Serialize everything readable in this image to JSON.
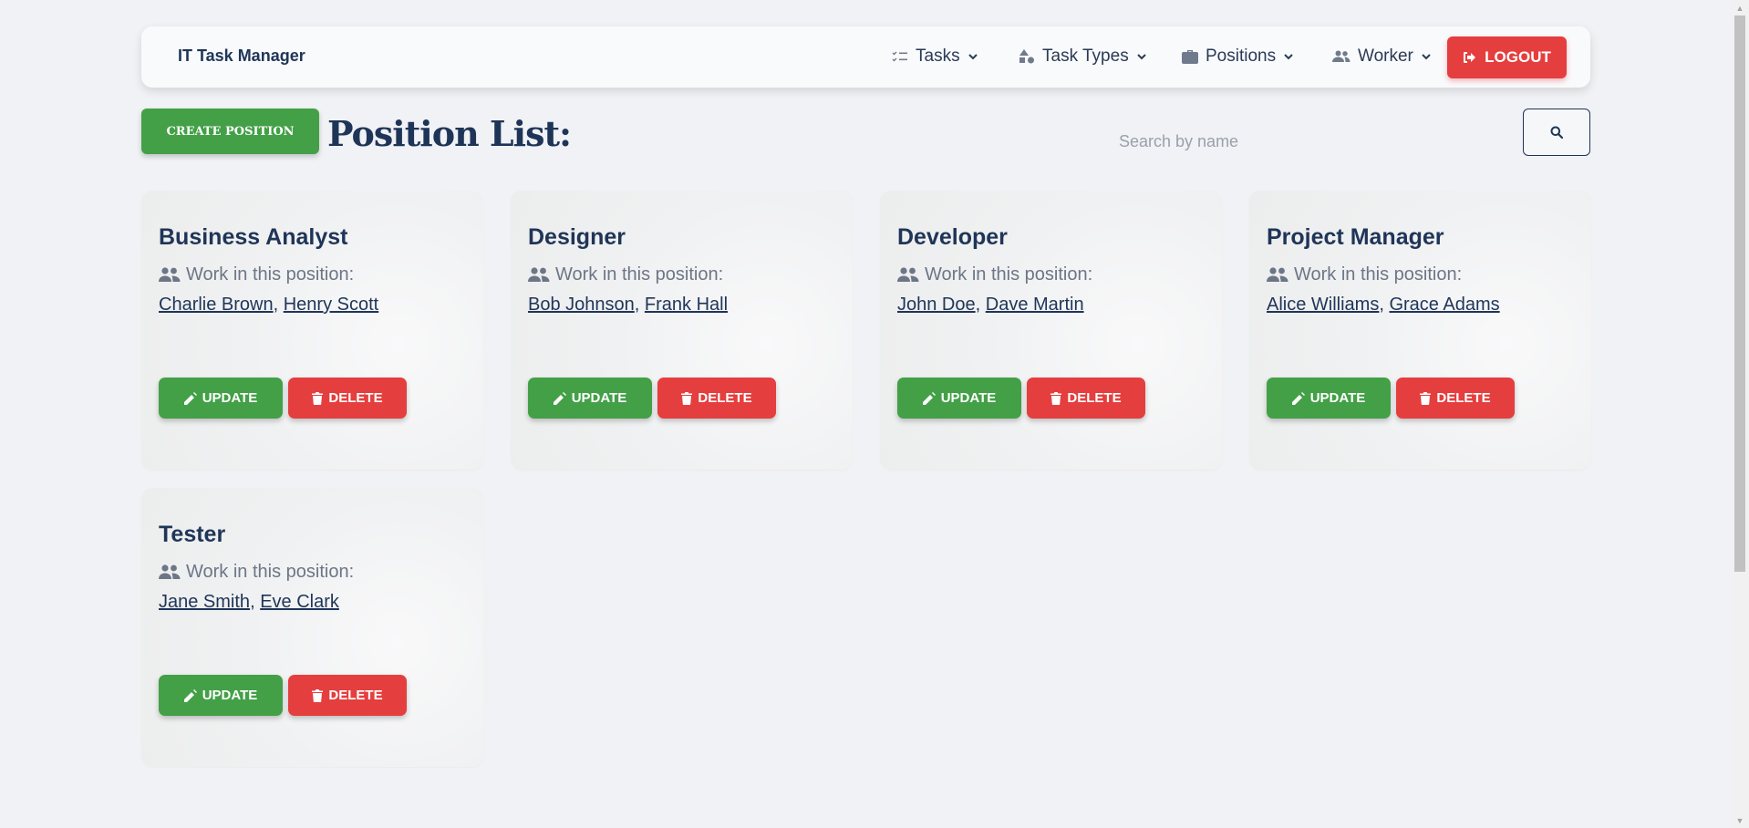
{
  "navbar": {
    "brand": "IT Task Manager",
    "tasks": "Tasks",
    "task_types": "Task Types",
    "positions": "Positions",
    "worker": "Worker",
    "logout": "LOGOUT"
  },
  "toolbar": {
    "create_label": "CREATE POSITION",
    "title": "Position List:",
    "search_placeholder": "Search by name",
    "search_value": ""
  },
  "card_labels": {
    "work_in_position": "Work in this position:",
    "update": "UPDATE",
    "delete": "DELETE"
  },
  "positions": [
    {
      "name": "Business Analyst",
      "workers": [
        "Charlie Brown",
        "Henry Scott"
      ]
    },
    {
      "name": "Designer",
      "workers": [
        "Bob Johnson",
        "Frank Hall"
      ]
    },
    {
      "name": "Developer",
      "workers": [
        "John Doe",
        "Dave Martin"
      ]
    },
    {
      "name": "Project Manager",
      "workers": [
        "Alice Williams",
        "Grace Adams"
      ]
    },
    {
      "name": "Tester",
      "workers": [
        "Jane Smith",
        "Eve Clark"
      ]
    }
  ],
  "colors": {
    "primary_text": "#1f3558",
    "success": "#43a047",
    "danger": "#e53e3e",
    "background": "#f0f2f5"
  }
}
